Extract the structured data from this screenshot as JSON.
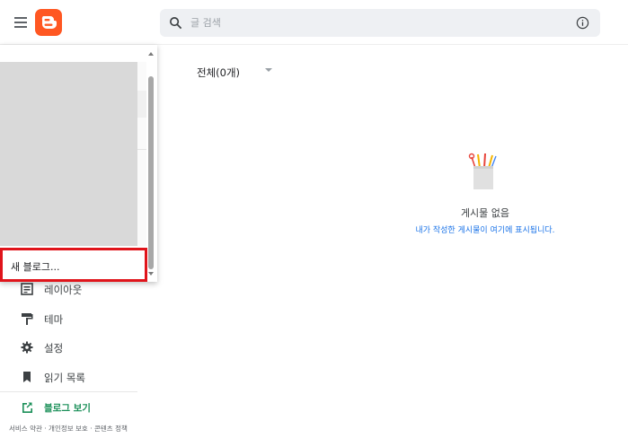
{
  "header": {
    "menu_icon": "hamburger-menu-icon",
    "logo_icon": "blogger-logo-icon",
    "search": {
      "placeholder": "글 검색",
      "value": ""
    },
    "info_icon": "info-icon"
  },
  "sidebar": {
    "items": [
      {
        "label": "레이아웃",
        "icon": "layout-icon"
      },
      {
        "label": "테마",
        "icon": "paint-roller-icon"
      },
      {
        "label": "설정",
        "icon": "gear-icon"
      },
      {
        "label": "읽기 목록",
        "icon": "bookmark-icon"
      }
    ],
    "view_blog": {
      "label": "블로그 보기",
      "icon": "open-in-new-icon"
    },
    "footer": {
      "terms": "서비스 약관",
      "privacy": "개인정보 보호",
      "content_policy": "콘텐츠 정책",
      "separator": " · "
    }
  },
  "blog_dropdown": {
    "new_blog_label": "새 블로그...",
    "highlight_color": "#e0141b"
  },
  "main": {
    "filter": {
      "label": "전체(0개)"
    },
    "empty_state": {
      "title": "게시물 없음",
      "subtitle": "내가 작성한 게시물이 여기에 표시됩니다.",
      "illustration": "pencil-cup-icon"
    }
  },
  "colors": {
    "brand": "#ff5722",
    "link": "#1a73e8",
    "view_blog": "#1a8f58"
  }
}
